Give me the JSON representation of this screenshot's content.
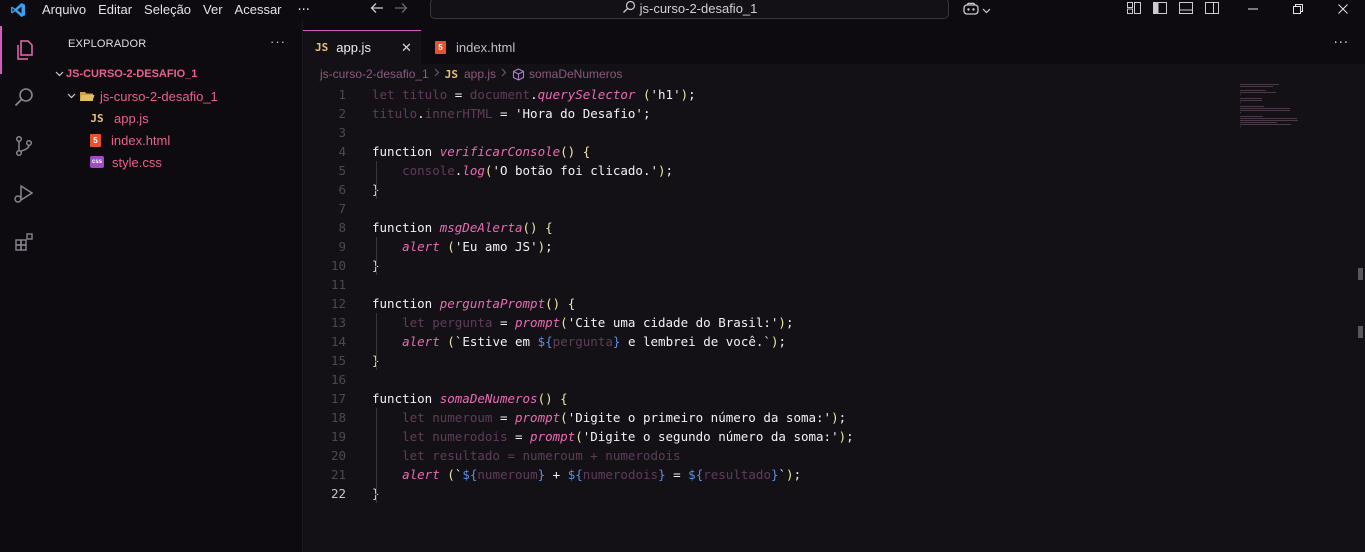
{
  "menu": {
    "items": [
      "Arquivo",
      "Editar",
      "Seleção",
      "Ver",
      "Acessar"
    ],
    "more": "···"
  },
  "search": {
    "text": "js-curso-2-desafio_1"
  },
  "explorer": {
    "title": "EXPLORADOR",
    "more": "···",
    "root": "JS-CURSO-2-DESAFIO_1",
    "folder": "js-curso-2-desafio_1",
    "files": [
      {
        "name": "app.js",
        "badge": "JS"
      },
      {
        "name": "index.html",
        "badge": "5"
      },
      {
        "name": "style.css",
        "badge": "css"
      }
    ]
  },
  "tabs": [
    {
      "label": "app.js",
      "badge": "JS",
      "close": "✕"
    },
    {
      "label": "index.html",
      "badge": "5"
    }
  ],
  "editor_more": "···",
  "breadcrumb": {
    "folder": "js-curso-2-desafio_1",
    "file_badge": "JS",
    "file": "app.js",
    "symbol": "somaDeNumeros"
  },
  "line_numbers": [
    "1",
    "2",
    "3",
    "4",
    "5",
    "6",
    "7",
    "8",
    "9",
    "10",
    "11",
    "12",
    "13",
    "14",
    "15",
    "16",
    "17",
    "18",
    "19",
    "20",
    "21",
    "22"
  ],
  "current_line": "22",
  "code": [
    [
      [
        "kw-dim",
        "let titulo"
      ],
      [
        "kw",
        " = "
      ],
      [
        "kw-dim",
        "document"
      ],
      [
        "kw",
        "."
      ],
      [
        "fn-call",
        "querySelector"
      ],
      [
        "kw",
        " "
      ],
      [
        "punc",
        "("
      ],
      [
        "str",
        "'h1'"
      ],
      [
        "punc",
        ")"
      ],
      [
        "kw",
        ";"
      ]
    ],
    [
      [
        "kw-dim",
        "titulo"
      ],
      [
        "kw",
        "."
      ],
      [
        "kw-dim",
        "innerHTML"
      ],
      [
        "kw",
        " = "
      ],
      [
        "str",
        "'Hora do Desafio'"
      ],
      [
        "kw",
        ";"
      ]
    ],
    [],
    [
      [
        "kw",
        "function "
      ],
      [
        "fn-def",
        "verificarConsole"
      ],
      [
        "punc",
        "()"
      ],
      [
        "kw",
        " "
      ],
      [
        "punc",
        "{"
      ]
    ],
    [
      [
        "kw",
        "    "
      ],
      [
        "kw-dim",
        "console"
      ],
      [
        "kw",
        "."
      ],
      [
        "fn-call",
        "log"
      ],
      [
        "punc",
        "("
      ],
      [
        "str",
        "'O botão foi clicado.'"
      ],
      [
        "punc",
        ")"
      ],
      [
        "kw",
        ";"
      ]
    ],
    [
      [
        "punc",
        "}"
      ]
    ],
    [],
    [
      [
        "kw",
        "function "
      ],
      [
        "fn-def",
        "msgDeAlerta"
      ],
      [
        "punc",
        "()"
      ],
      [
        "kw",
        " "
      ],
      [
        "punc",
        "{"
      ]
    ],
    [
      [
        "kw",
        "    "
      ],
      [
        "fn-call",
        "alert"
      ],
      [
        "kw",
        " "
      ],
      [
        "punc",
        "("
      ],
      [
        "str",
        "'Eu amo JS'"
      ],
      [
        "punc",
        ")"
      ],
      [
        "kw",
        ";"
      ]
    ],
    [
      [
        "punc",
        "}"
      ]
    ],
    [],
    [
      [
        "kw",
        "function "
      ],
      [
        "fn-def",
        "perguntaPrompt"
      ],
      [
        "punc",
        "()"
      ],
      [
        "kw",
        " "
      ],
      [
        "punc",
        "{"
      ]
    ],
    [
      [
        "kw",
        "    "
      ],
      [
        "kw-dim",
        "let pergunta"
      ],
      [
        "kw",
        " = "
      ],
      [
        "fn-call",
        "prompt"
      ],
      [
        "punc",
        "("
      ],
      [
        "str",
        "'Cite uma cidade do Brasil:'"
      ],
      [
        "punc",
        ")"
      ],
      [
        "kw",
        ";"
      ]
    ],
    [
      [
        "kw",
        "    "
      ],
      [
        "fn-call",
        "alert"
      ],
      [
        "kw",
        " "
      ],
      [
        "punc",
        "("
      ],
      [
        "str",
        "`Estive em "
      ],
      [
        "tmpl",
        "${"
      ],
      [
        "var-dim",
        "pergunta"
      ],
      [
        "tmpl",
        "}"
      ],
      [
        "str",
        " e lembrei de você.`"
      ],
      [
        "punc",
        ")"
      ],
      [
        "kw",
        ";"
      ]
    ],
    [
      [
        "punc",
        "}"
      ]
    ],
    [],
    [
      [
        "kw",
        "function "
      ],
      [
        "fn-def",
        "somaDeNumeros"
      ],
      [
        "punc",
        "()"
      ],
      [
        "kw",
        " "
      ],
      [
        "punc",
        "{"
      ]
    ],
    [
      [
        "kw",
        "    "
      ],
      [
        "kw-dim",
        "let numeroum"
      ],
      [
        "kw",
        " = "
      ],
      [
        "fn-call",
        "prompt"
      ],
      [
        "punc",
        "("
      ],
      [
        "str",
        "'Digite o primeiro número da soma:'"
      ],
      [
        "punc",
        ")"
      ],
      [
        "kw",
        ";"
      ]
    ],
    [
      [
        "kw",
        "    "
      ],
      [
        "kw-dim",
        "let numerodois"
      ],
      [
        "kw",
        " = "
      ],
      [
        "fn-call",
        "prompt"
      ],
      [
        "punc",
        "("
      ],
      [
        "str",
        "'Digite o segundo número da soma:'"
      ],
      [
        "punc",
        ")"
      ],
      [
        "kw",
        ";"
      ]
    ],
    [
      [
        "kw",
        "    "
      ],
      [
        "kw-dim",
        "let resultado = numeroum + numerodois"
      ]
    ],
    [
      [
        "kw",
        "    "
      ],
      [
        "fn-call",
        "alert"
      ],
      [
        "kw",
        " "
      ],
      [
        "punc",
        "("
      ],
      [
        "str",
        "`"
      ],
      [
        "tmpl",
        "${"
      ],
      [
        "var-dim",
        "numeroum"
      ],
      [
        "tmpl",
        "}"
      ],
      [
        "str",
        " + "
      ],
      [
        "tmpl",
        "${"
      ],
      [
        "var-dim",
        "numerodois"
      ],
      [
        "tmpl",
        "}"
      ],
      [
        "str",
        " = "
      ],
      [
        "tmpl",
        "${"
      ],
      [
        "var-dim",
        "resultado"
      ],
      [
        "tmpl",
        "}"
      ],
      [
        "str",
        "`"
      ],
      [
        "punc",
        ")"
      ],
      [
        "kw",
        ";"
      ]
    ],
    [
      [
        "punc",
        "}"
      ]
    ]
  ]
}
